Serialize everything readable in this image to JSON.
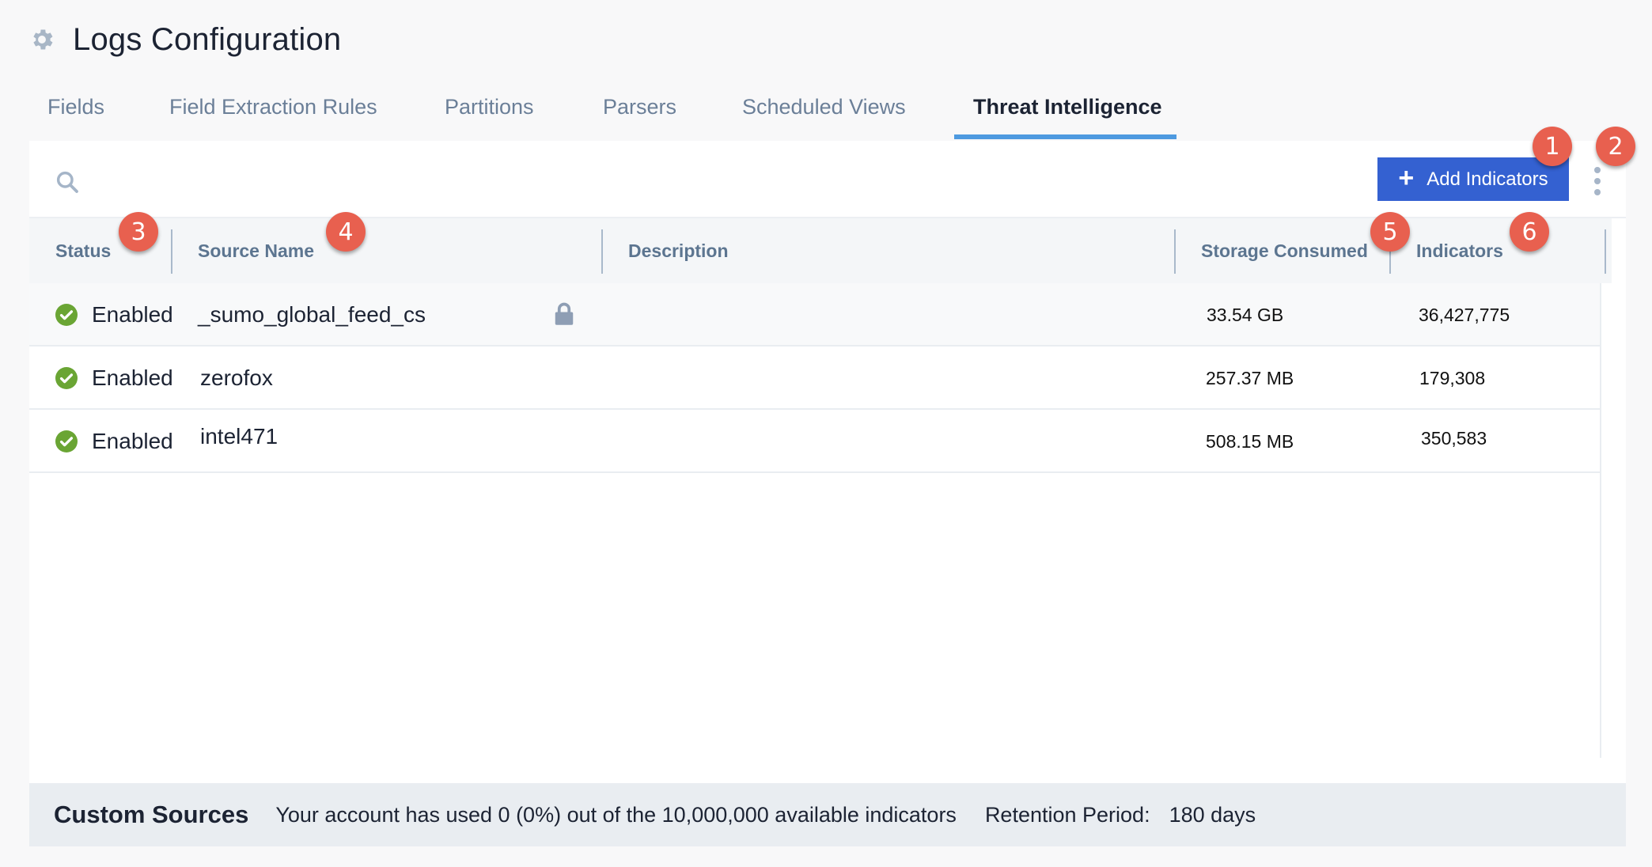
{
  "header": {
    "title": "Logs Configuration",
    "icon": "gear-icon"
  },
  "tabs": [
    {
      "label": "Fields",
      "active": false
    },
    {
      "label": "Field Extraction Rules",
      "active": false
    },
    {
      "label": "Partitions",
      "active": false
    },
    {
      "label": "Parsers",
      "active": false
    },
    {
      "label": "Scheduled Views",
      "active": false
    },
    {
      "label": "Threat Intelligence",
      "active": true
    }
  ],
  "toolbar": {
    "search_placeholder": "",
    "add_button_label": "Add Indicators",
    "add_button_icon": "plus-icon",
    "more_icon": "kebab-menu-icon"
  },
  "table": {
    "columns": [
      "Status",
      "Source Name",
      "Description",
      "Storage Consumed",
      "Indicators"
    ],
    "rows": [
      {
        "status": "Enabled",
        "source_name": "_sumo_global_feed_cs",
        "locked": true,
        "description": "",
        "storage": "33.54 GB",
        "indicators": "36,427,775"
      },
      {
        "status": "Enabled",
        "source_name": "zerofox",
        "locked": false,
        "description": "",
        "storage": "257.37 MB",
        "indicators": "179,308"
      },
      {
        "status": "Enabled",
        "source_name": "intel471",
        "locked": false,
        "description": "",
        "storage": "508.15 MB",
        "indicators": "350,583"
      }
    ]
  },
  "footer": {
    "title": "Custom Sources",
    "usage_text": "Your account has used 0 (0%) out of the 10,000,000 available indicators",
    "retention_label": "Retention Period:",
    "retention_value": "180 days"
  },
  "annotations": [
    "1",
    "2",
    "3",
    "4",
    "5",
    "6"
  ],
  "colors": {
    "accent": "#3461d1",
    "tab_underline": "#4e9ae0",
    "status_enabled": "#6aa534",
    "badge": "#e8604f"
  }
}
